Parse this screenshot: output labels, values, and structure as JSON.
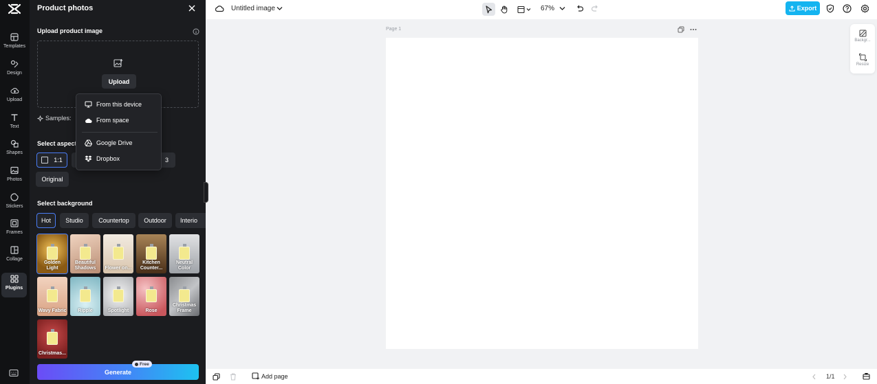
{
  "rail": {
    "items": [
      {
        "label": "Templates",
        "icon": "templates-icon"
      },
      {
        "label": "Design",
        "icon": "design-icon"
      },
      {
        "label": "Upload",
        "icon": "upload-cloud-icon"
      },
      {
        "label": "Text",
        "icon": "text-icon"
      },
      {
        "label": "Shapes",
        "icon": "shapes-icon"
      },
      {
        "label": "Photos",
        "icon": "photos-icon"
      },
      {
        "label": "Stickers",
        "icon": "stickers-icon"
      },
      {
        "label": "Frames",
        "icon": "frames-icon"
      },
      {
        "label": "Collage",
        "icon": "collage-icon"
      },
      {
        "label": "Plugins",
        "icon": "plugins-icon"
      }
    ]
  },
  "panel": {
    "title": "Product photos",
    "upload_section": "Upload product image",
    "upload_button": "Upload",
    "samples_label": "Samples:",
    "aspect_section": "Select aspect",
    "aspect_options": [
      "1:1",
      "3",
      "Original"
    ],
    "background_section": "Select background",
    "background_tabs": [
      "Hot",
      "Studio",
      "Countertop",
      "Outdoor",
      "Interio"
    ],
    "backgrounds": [
      {
        "label": "Golden Light",
        "color": "#8a5a14"
      },
      {
        "label": "Beautiful Shadows",
        "color": "#c9a48d"
      },
      {
        "label": "Flower on...",
        "color": "#e6d8c6"
      },
      {
        "label": "Kitchen Counter...",
        "color": "#6b4a2a"
      },
      {
        "label": "Neutral Color",
        "color": "#b9bcc1"
      },
      {
        "label": "Wavy Fabric",
        "color": "#e9c1a8"
      },
      {
        "label": "Ripple",
        "color": "#a9cfd8"
      },
      {
        "label": "Spotlight",
        "color": "#d6d7d9"
      },
      {
        "label": "Rose",
        "color": "#e8a4a6"
      },
      {
        "label": "Christmas Frame",
        "color": "#7d7f82"
      },
      {
        "label": "Christmas...",
        "color": "#9a2b2b"
      }
    ],
    "generate_button": "Generate",
    "free_badge": "Free"
  },
  "upload_menu": {
    "items": [
      {
        "label": "From this device",
        "icon": "monitor-icon"
      },
      {
        "label": "From space",
        "icon": "cloud-icon"
      },
      {
        "label": "Google Drive",
        "icon": "google-drive-icon"
      },
      {
        "label": "Dropbox",
        "icon": "dropbox-icon"
      }
    ]
  },
  "topbar": {
    "doc_title": "Untitled image",
    "zoom": "67%",
    "export_label": "Export"
  },
  "canvas": {
    "page_label": "Page 1"
  },
  "right_float": {
    "items": [
      {
        "label": "Backgr...",
        "icon": "background-icon"
      },
      {
        "label": "Resize",
        "icon": "resize-icon"
      }
    ]
  },
  "bottombar": {
    "add_page": "Add page",
    "page_count": "1/1"
  },
  "colors": {
    "accent": "#4a7df5",
    "export": "#14b4f0",
    "panel_bg": "#1b1c1f",
    "rail_bg": "#111214"
  }
}
